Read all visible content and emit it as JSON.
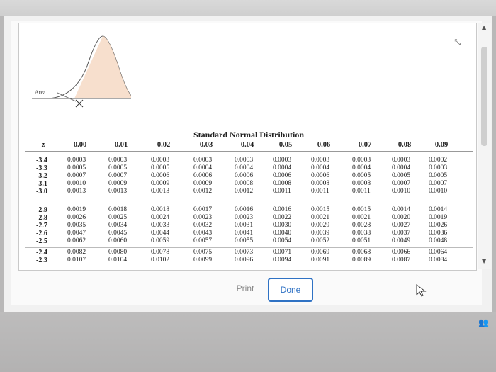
{
  "title": "Standard Normal Distribution",
  "area_label": "Area",
  "z_axis_label": "z",
  "z_header": "z",
  "column_headers": [
    "0.00",
    "0.01",
    "0.02",
    "0.03",
    "0.04",
    "0.05",
    "0.06",
    "0.07",
    "0.08",
    "0.09"
  ],
  "groups": [
    {
      "rows": [
        {
          "z": "-3.4",
          "values": [
            "0.0003",
            "0.0003",
            "0.0003",
            "0.0003",
            "0.0003",
            "0.0003",
            "0.0003",
            "0.0003",
            "0.0003",
            "0.0002"
          ]
        },
        {
          "z": "-3.3",
          "values": [
            "0.0005",
            "0.0005",
            "0.0005",
            "0.0004",
            "0.0004",
            "0.0004",
            "0.0004",
            "0.0004",
            "0.0004",
            "0.0003"
          ]
        },
        {
          "z": "-3.2",
          "values": [
            "0.0007",
            "0.0007",
            "0.0006",
            "0.0006",
            "0.0006",
            "0.0006",
            "0.0006",
            "0.0005",
            "0.0005",
            "0.0005"
          ]
        },
        {
          "z": "-3.1",
          "values": [
            "0.0010",
            "0.0009",
            "0.0009",
            "0.0009",
            "0.0008",
            "0.0008",
            "0.0008",
            "0.0008",
            "0.0007",
            "0.0007"
          ]
        },
        {
          "z": "-3.0",
          "values": [
            "0.0013",
            "0.0013",
            "0.0013",
            "0.0012",
            "0.0012",
            "0.0011",
            "0.0011",
            "0.0011",
            "0.0010",
            "0.0010"
          ]
        }
      ]
    },
    {
      "rows": [
        {
          "z": "-2.9",
          "values": [
            "0.0019",
            "0.0018",
            "0.0018",
            "0.0017",
            "0.0016",
            "0.0016",
            "0.0015",
            "0.0015",
            "0.0014",
            "0.0014"
          ]
        },
        {
          "z": "-2.8",
          "values": [
            "0.0026",
            "0.0025",
            "0.0024",
            "0.0023",
            "0.0023",
            "0.0022",
            "0.0021",
            "0.0021",
            "0.0020",
            "0.0019"
          ]
        },
        {
          "z": "-2.7",
          "values": [
            "0.0035",
            "0.0034",
            "0.0033",
            "0.0032",
            "0.0031",
            "0.0030",
            "0.0029",
            "0.0028",
            "0.0027",
            "0.0026"
          ]
        },
        {
          "z": "-2.6",
          "values": [
            "0.0047",
            "0.0045",
            "0.0044",
            "0.0043",
            "0.0041",
            "0.0040",
            "0.0039",
            "0.0038",
            "0.0037",
            "0.0036"
          ]
        },
        {
          "z": "-2.5",
          "values": [
            "0.0062",
            "0.0060",
            "0.0059",
            "0.0057",
            "0.0055",
            "0.0054",
            "0.0052",
            "0.0051",
            "0.0049",
            "0.0048"
          ]
        }
      ]
    },
    {
      "rows": [
        {
          "z": "-2.4",
          "values": [
            "0.0082",
            "0.0080",
            "0.0078",
            "0.0075",
            "0.0073",
            "0.0071",
            "0.0069",
            "0.0068",
            "0.0066",
            "0.0064"
          ]
        },
        {
          "z": "-2.3",
          "values": [
            "0.0107",
            "0.0104",
            "0.0102",
            "0.0099",
            "0.0096",
            "0.0094",
            "0.0091",
            "0.0089",
            "0.0087",
            "0.0084"
          ]
        }
      ]
    }
  ],
  "buttons": {
    "print": "Print",
    "done": "Done"
  },
  "colors": {
    "accent": "#2f72c4",
    "curve_fill": "#f6d9c4"
  },
  "icons": {
    "minimize": "minimize-icon",
    "corner": "people-icon"
  }
}
